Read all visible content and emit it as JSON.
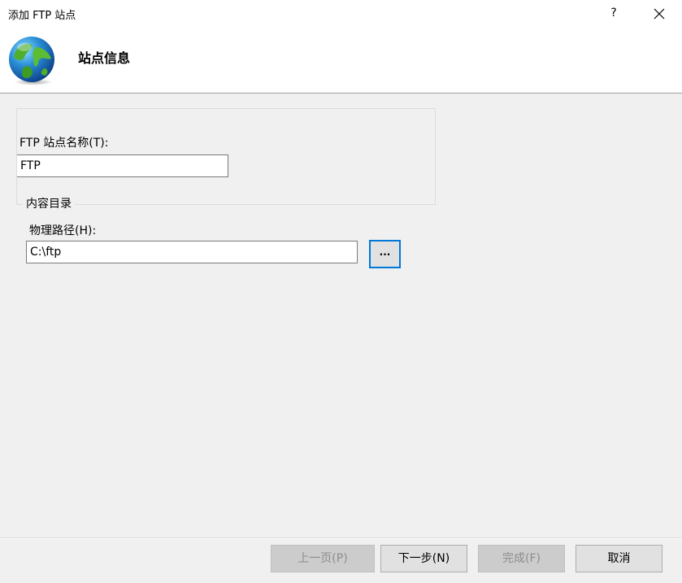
{
  "window": {
    "title": "添加 FTP 站点",
    "help_label": "?"
  },
  "header": {
    "title": "站点信息",
    "icon": "globe-icon"
  },
  "form": {
    "site_name_label": "FTP 站点名称(T):",
    "site_name_value": "FTP",
    "content_dir_legend": "内容目录",
    "physical_path_label": "物理路径(H):",
    "physical_path_value": "C:\\ftp",
    "browse_label": "..."
  },
  "footer": {
    "prev_label": "上一页(P)",
    "next_label": "下一步(N)",
    "finish_label": "完成(F)",
    "cancel_label": "取消"
  },
  "colors": {
    "accent": "#0078d7",
    "background": "#f0f0f0"
  }
}
